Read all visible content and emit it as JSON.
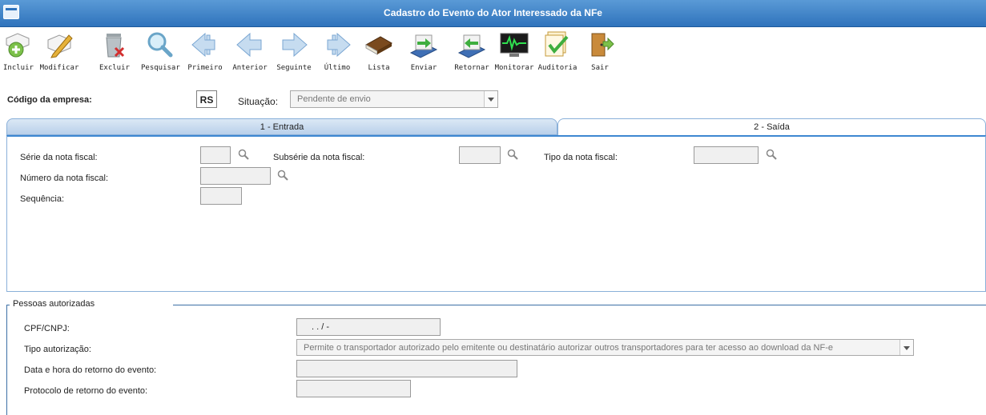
{
  "window": {
    "title": "Cadastro do Evento do Ator Interessado da NFe"
  },
  "toolbar": {
    "buttons": [
      {
        "label": "Incluir",
        "icon": "add-icon"
      },
      {
        "label": "Modificar",
        "icon": "edit-icon"
      },
      {
        "label": "Excluir",
        "icon": "trash-icon"
      },
      {
        "label": "Pesquisar",
        "icon": "search-icon"
      },
      {
        "label": "Primeiro",
        "icon": "first-arrow-icon"
      },
      {
        "label": "Anterior",
        "icon": "previous-arrow-icon"
      },
      {
        "label": "Seguinte",
        "icon": "next-arrow-icon"
      },
      {
        "label": "Último",
        "icon": "last-arrow-icon"
      },
      {
        "label": "Lista",
        "icon": "book-icon"
      },
      {
        "label": "Enviar",
        "icon": "send-icon"
      },
      {
        "label": "Retornar",
        "icon": "return-icon"
      },
      {
        "label": "Monitorar",
        "icon": "monitor-icon"
      },
      {
        "label": "Auditoria",
        "icon": "audit-icon"
      },
      {
        "label": "Sair",
        "icon": "exit-door-icon"
      }
    ]
  },
  "header": {
    "company_label": "Código da empresa:",
    "company_value": "RS",
    "status_label": "Situação:",
    "status_value": "Pendente de envio"
  },
  "tabs": [
    {
      "label": "1 - Entrada",
      "active": false
    },
    {
      "label": "2 - Saída",
      "active": true
    }
  ],
  "form": {
    "serie_label": "Série da nota fiscal:",
    "subserie_label": "Subsérie da nota fiscal:",
    "tipo_label": "Tipo da nota fiscal:",
    "numero_label": "Número da nota fiscal:",
    "sequencia_label": "Sequência:"
  },
  "authorized": {
    "group_title": "Pessoas autorizadas",
    "cpf_label": "CPF/CNPJ:",
    "cpf_value": ". . / -",
    "tipo_label": "Tipo autorização:",
    "tipo_value": "Permite o transportador autorizado pelo emitente ou destinatário autorizar outros transportadores para ter acesso ao download da NF-e",
    "data_label": "Data e hora do retorno do evento:",
    "protocolo_label": "Protocolo de retorno do evento:"
  }
}
